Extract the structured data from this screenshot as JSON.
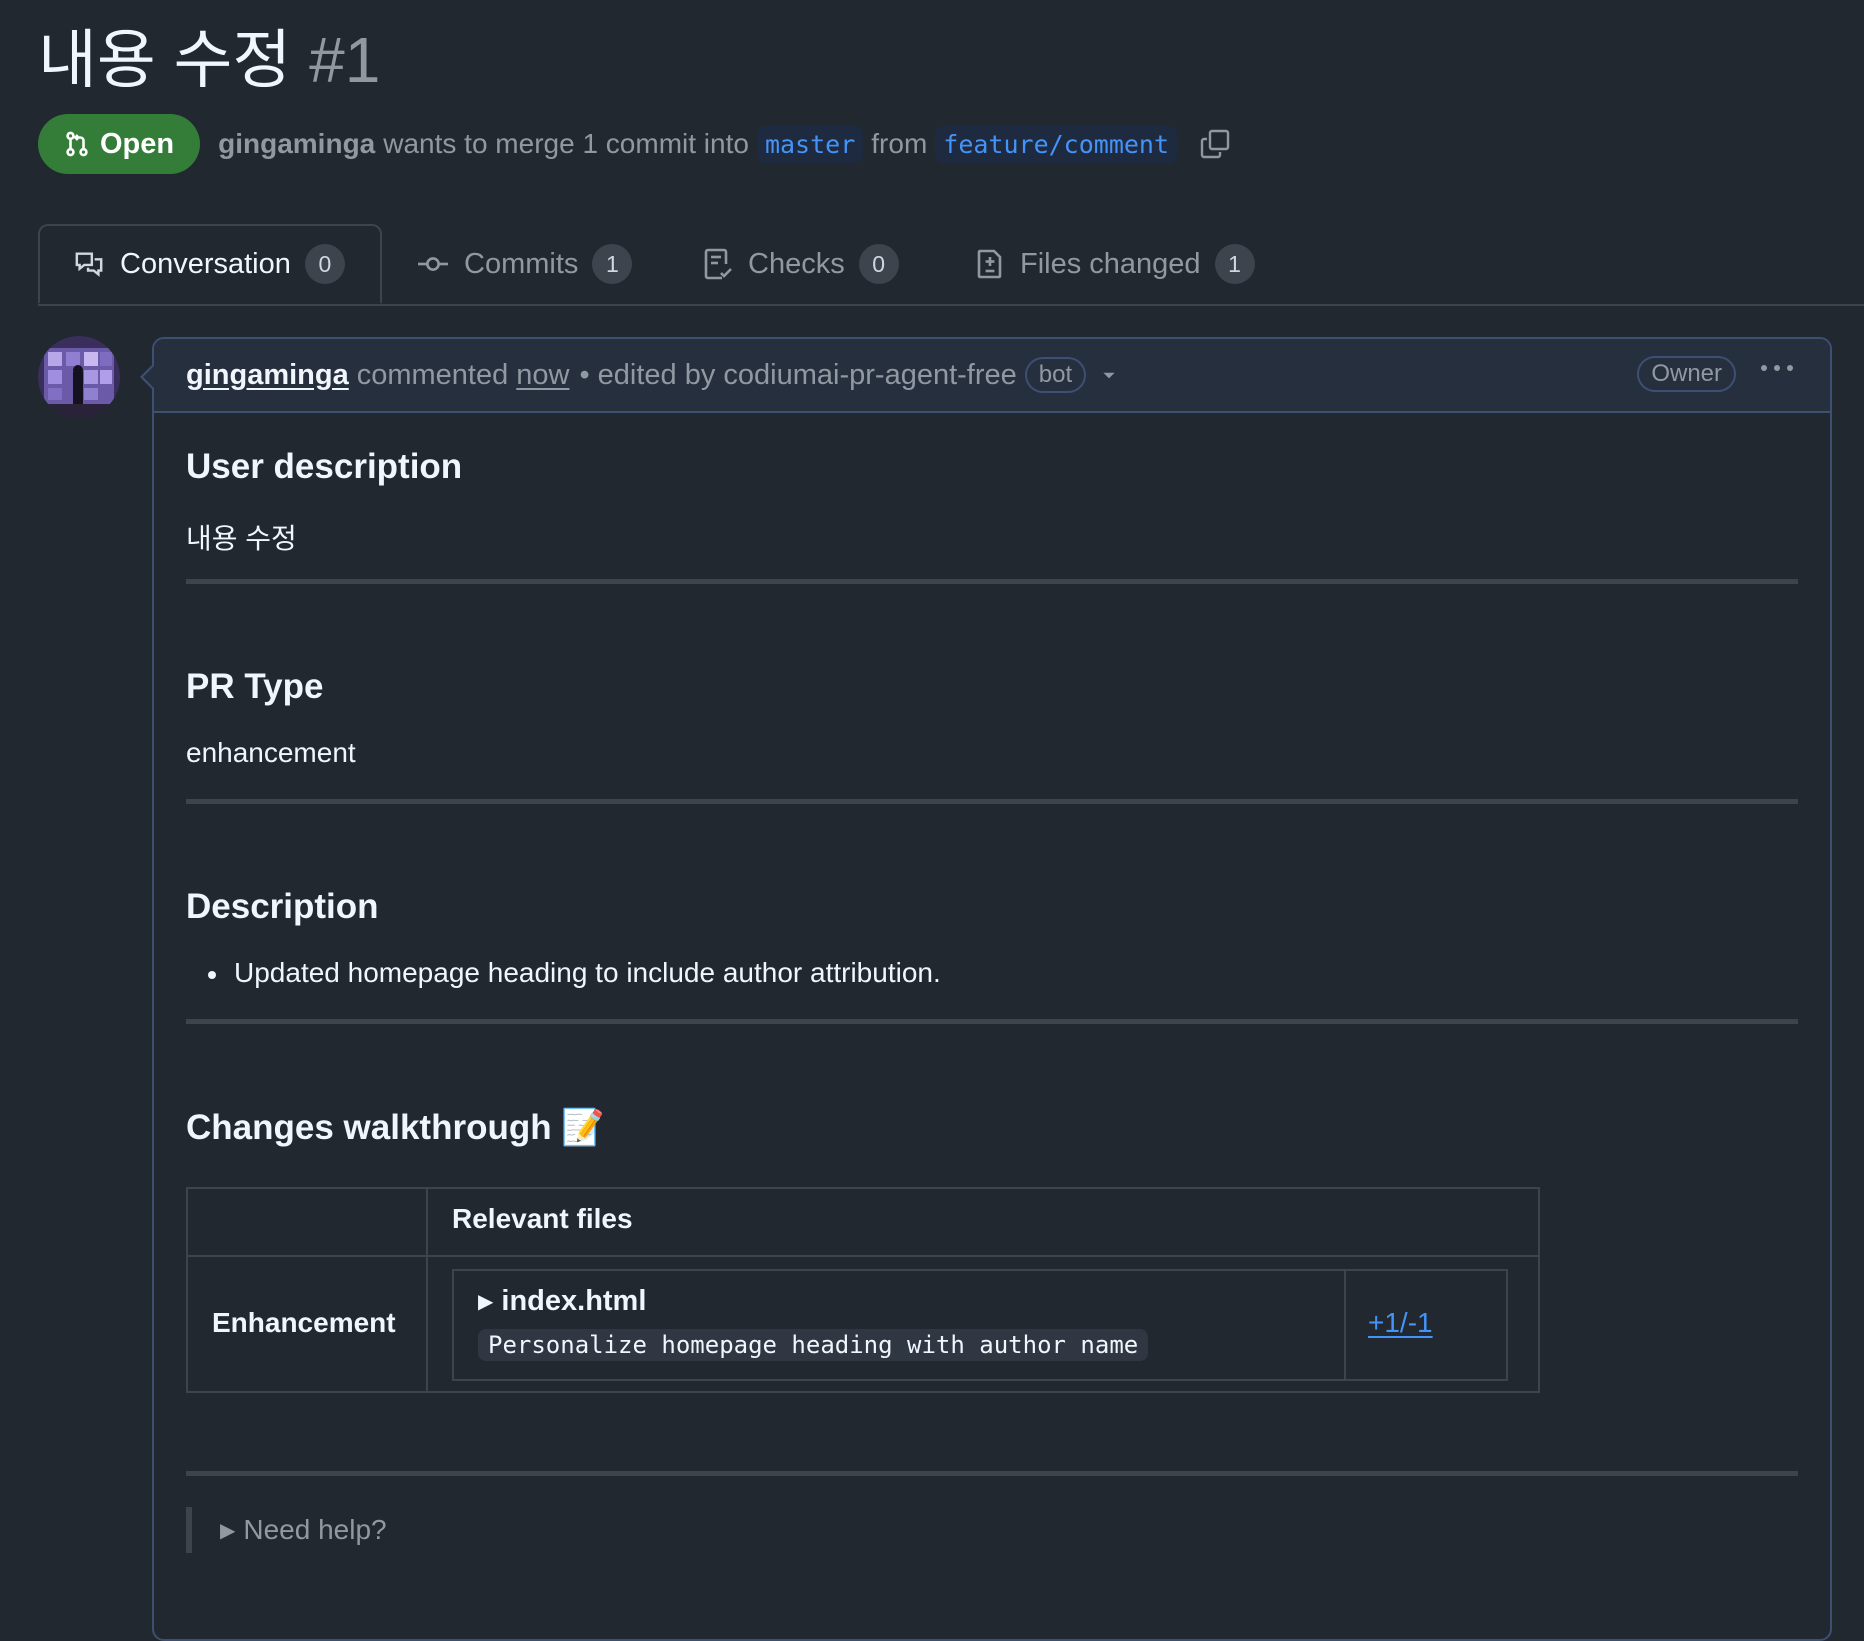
{
  "pr": {
    "title": "내용 수정",
    "number": "#1",
    "state": "Open",
    "author": "gingaminga",
    "merge_text": "wants to merge 1 commit into",
    "base_branch": "master",
    "from_text": "from",
    "head_branch": "feature/comment"
  },
  "tabs": [
    {
      "label": "Conversation",
      "count": "0"
    },
    {
      "label": "Commits",
      "count": "1"
    },
    {
      "label": "Checks",
      "count": "0"
    },
    {
      "label": "Files changed",
      "count": "1"
    }
  ],
  "comment": {
    "author": "gingaminga",
    "action": "commented",
    "time": "now",
    "edited_text": "• edited by codiumai-pr-agent-free",
    "bot_badge": "bot",
    "role_badge": "Owner"
  },
  "content": {
    "user_desc_heading": "User description",
    "user_desc_text": "내용 수정",
    "pr_type_heading": "PR Type",
    "pr_type_text": "enhancement",
    "description_heading": "Description",
    "description_items": [
      "Updated homepage heading to include author attribution."
    ],
    "walkthrough_heading": "Changes walkthrough 📝",
    "walkthrough": {
      "header": "Relevant files",
      "category": "Enhancement",
      "file_name": "index.html",
      "file_summary": "Personalize homepage heading with author name",
      "diff": "+1/-1"
    },
    "help_text": "Need help?"
  },
  "colors": {
    "background": "#212830",
    "open_green": "#347d39",
    "link_blue": "#4493f8",
    "border": "#3d444d"
  }
}
